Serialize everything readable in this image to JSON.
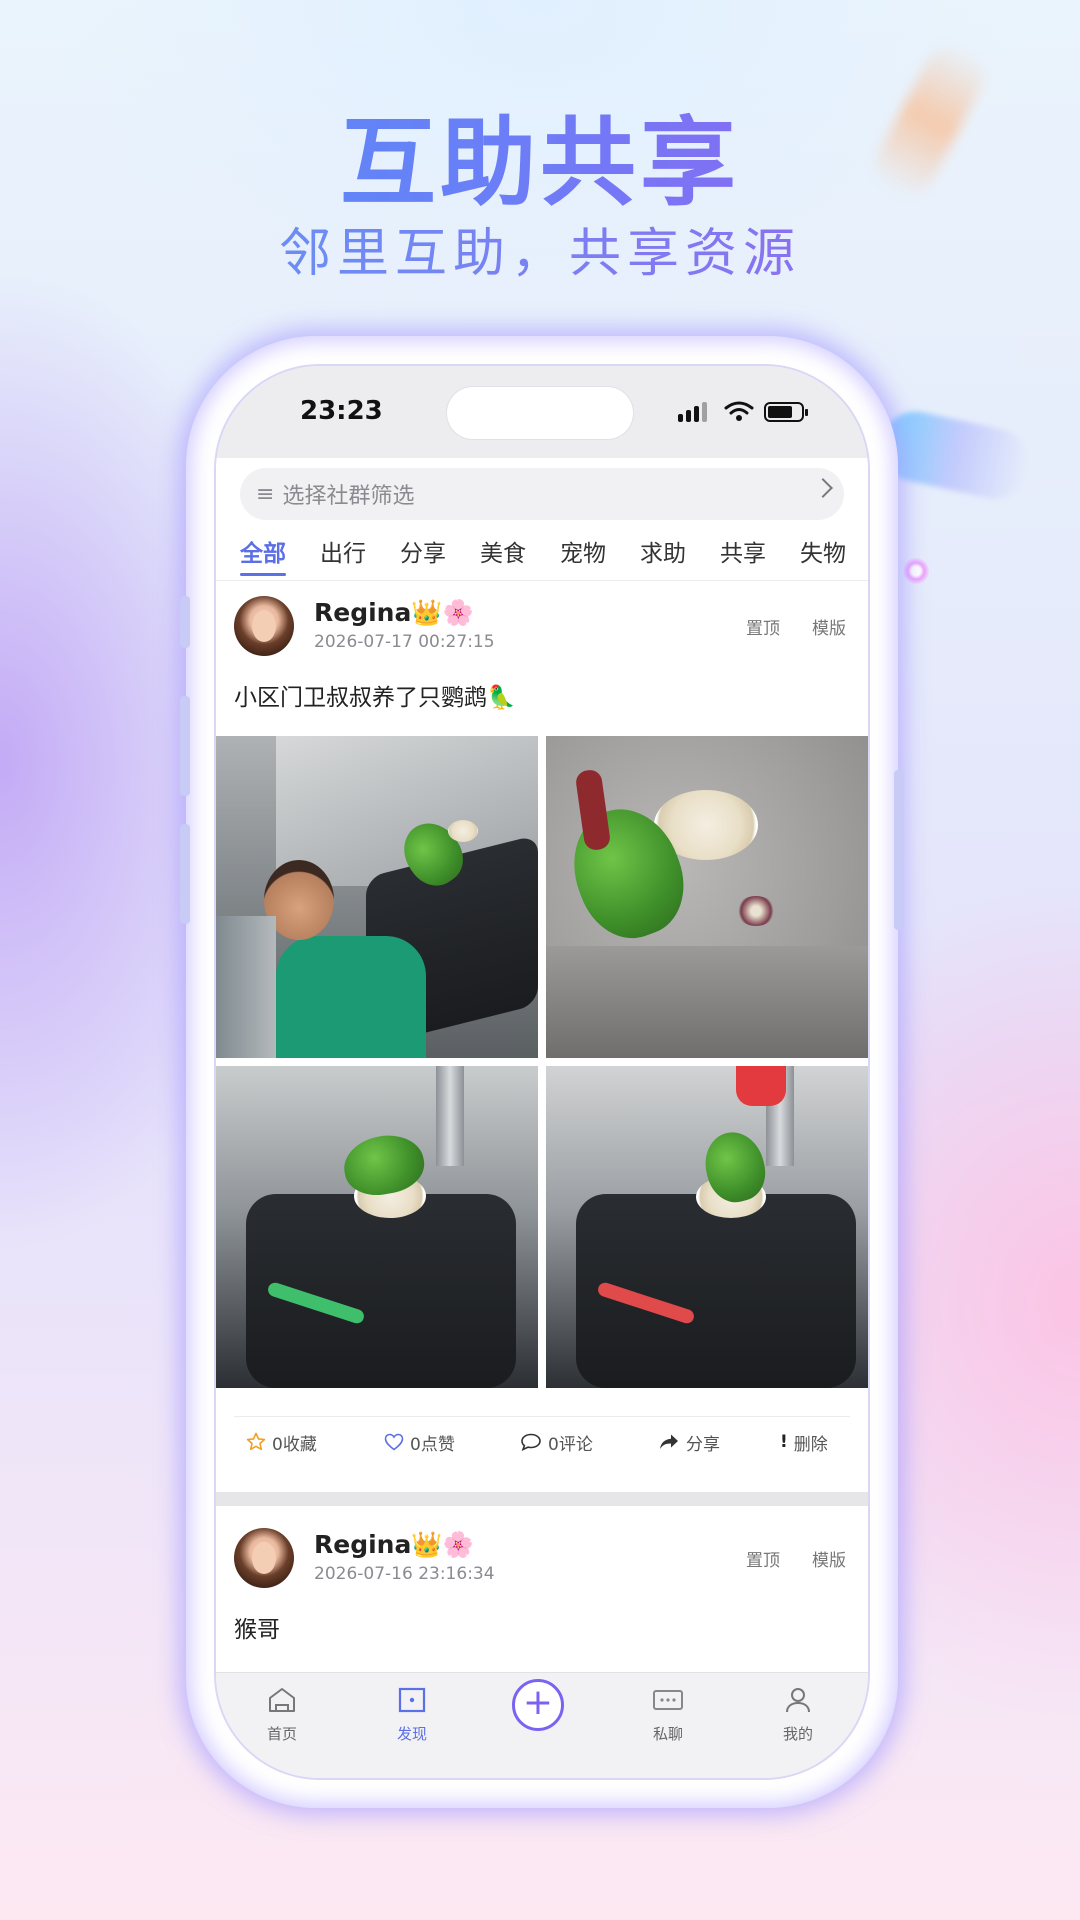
{
  "hero": {
    "title": "互助共享",
    "subtitle": "邻里互助，共享资源"
  },
  "status_bar": {
    "time": "23:23"
  },
  "filter": {
    "placeholder": "选择社群筛选"
  },
  "tabs": [
    {
      "label": "全部",
      "active": true
    },
    {
      "label": "出行"
    },
    {
      "label": "分享"
    },
    {
      "label": "美食"
    },
    {
      "label": "宠物"
    },
    {
      "label": "求助"
    },
    {
      "label": "共享"
    },
    {
      "label": "失物"
    }
  ],
  "posts": [
    {
      "user": "Regina👑🌸",
      "date": "2026-07-17 00:27:15",
      "pin_label": "置顶",
      "template_label": "模版",
      "text": "小区门卫叔叔养了只鹦鹉🦜",
      "actions": {
        "favorite": "0收藏",
        "like": "0点赞",
        "comment": "0评论",
        "share": "分享",
        "delete": "删除"
      }
    },
    {
      "user": "Regina👑🌸",
      "date": "2026-07-16 23:16:34",
      "pin_label": "置顶",
      "template_label": "模版",
      "text": "猴哥"
    }
  ],
  "tabbar": [
    {
      "label": "首页",
      "icon": "home-icon"
    },
    {
      "label": "发现",
      "icon": "discover-icon",
      "active": true
    },
    {
      "label": "",
      "icon": "plus-icon"
    },
    {
      "label": "私聊",
      "icon": "chat-icon"
    },
    {
      "label": "我的",
      "icon": "profile-icon"
    }
  ],
  "colors": {
    "accent": "#5b6fe6",
    "plus": "#7b62f0",
    "star": "#f0a020",
    "like": "#5b6fe6"
  }
}
